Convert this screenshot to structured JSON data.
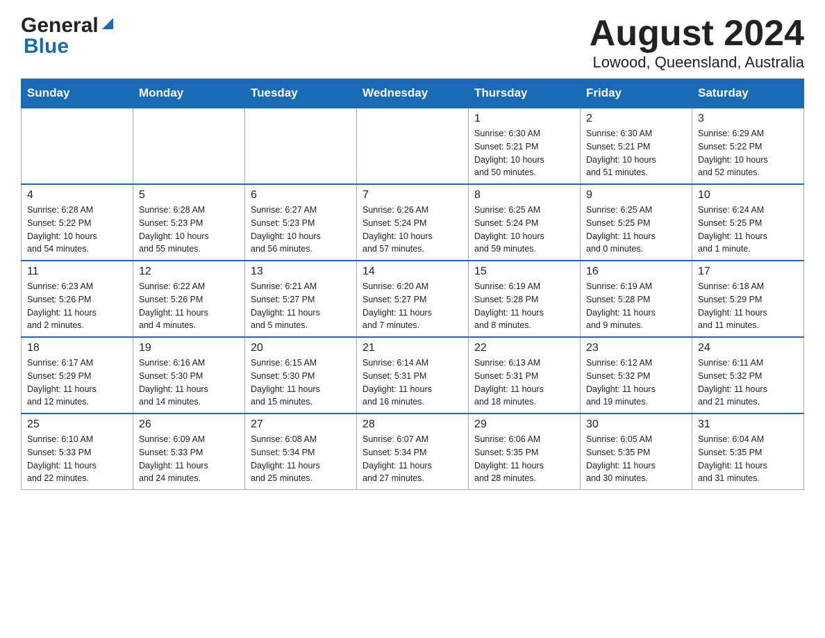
{
  "header": {
    "logo_general": "General",
    "logo_blue": "Blue",
    "title": "August 2024",
    "subtitle": "Lowood, Queensland, Australia"
  },
  "days_of_week": [
    "Sunday",
    "Monday",
    "Tuesday",
    "Wednesday",
    "Thursday",
    "Friday",
    "Saturday"
  ],
  "weeks": [
    [
      {
        "day": "",
        "info": ""
      },
      {
        "day": "",
        "info": ""
      },
      {
        "day": "",
        "info": ""
      },
      {
        "day": "",
        "info": ""
      },
      {
        "day": "1",
        "info": "Sunrise: 6:30 AM\nSunset: 5:21 PM\nDaylight: 10 hours\nand 50 minutes."
      },
      {
        "day": "2",
        "info": "Sunrise: 6:30 AM\nSunset: 5:21 PM\nDaylight: 10 hours\nand 51 minutes."
      },
      {
        "day": "3",
        "info": "Sunrise: 6:29 AM\nSunset: 5:22 PM\nDaylight: 10 hours\nand 52 minutes."
      }
    ],
    [
      {
        "day": "4",
        "info": "Sunrise: 6:28 AM\nSunset: 5:22 PM\nDaylight: 10 hours\nand 54 minutes."
      },
      {
        "day": "5",
        "info": "Sunrise: 6:28 AM\nSunset: 5:23 PM\nDaylight: 10 hours\nand 55 minutes."
      },
      {
        "day": "6",
        "info": "Sunrise: 6:27 AM\nSunset: 5:23 PM\nDaylight: 10 hours\nand 56 minutes."
      },
      {
        "day": "7",
        "info": "Sunrise: 6:26 AM\nSunset: 5:24 PM\nDaylight: 10 hours\nand 57 minutes."
      },
      {
        "day": "8",
        "info": "Sunrise: 6:25 AM\nSunset: 5:24 PM\nDaylight: 10 hours\nand 59 minutes."
      },
      {
        "day": "9",
        "info": "Sunrise: 6:25 AM\nSunset: 5:25 PM\nDaylight: 11 hours\nand 0 minutes."
      },
      {
        "day": "10",
        "info": "Sunrise: 6:24 AM\nSunset: 5:25 PM\nDaylight: 11 hours\nand 1 minute."
      }
    ],
    [
      {
        "day": "11",
        "info": "Sunrise: 6:23 AM\nSunset: 5:26 PM\nDaylight: 11 hours\nand 2 minutes."
      },
      {
        "day": "12",
        "info": "Sunrise: 6:22 AM\nSunset: 5:26 PM\nDaylight: 11 hours\nand 4 minutes."
      },
      {
        "day": "13",
        "info": "Sunrise: 6:21 AM\nSunset: 5:27 PM\nDaylight: 11 hours\nand 5 minutes."
      },
      {
        "day": "14",
        "info": "Sunrise: 6:20 AM\nSunset: 5:27 PM\nDaylight: 11 hours\nand 7 minutes."
      },
      {
        "day": "15",
        "info": "Sunrise: 6:19 AM\nSunset: 5:28 PM\nDaylight: 11 hours\nand 8 minutes."
      },
      {
        "day": "16",
        "info": "Sunrise: 6:19 AM\nSunset: 5:28 PM\nDaylight: 11 hours\nand 9 minutes."
      },
      {
        "day": "17",
        "info": "Sunrise: 6:18 AM\nSunset: 5:29 PM\nDaylight: 11 hours\nand 11 minutes."
      }
    ],
    [
      {
        "day": "18",
        "info": "Sunrise: 6:17 AM\nSunset: 5:29 PM\nDaylight: 11 hours\nand 12 minutes."
      },
      {
        "day": "19",
        "info": "Sunrise: 6:16 AM\nSunset: 5:30 PM\nDaylight: 11 hours\nand 14 minutes."
      },
      {
        "day": "20",
        "info": "Sunrise: 6:15 AM\nSunset: 5:30 PM\nDaylight: 11 hours\nand 15 minutes."
      },
      {
        "day": "21",
        "info": "Sunrise: 6:14 AM\nSunset: 5:31 PM\nDaylight: 11 hours\nand 16 minutes."
      },
      {
        "day": "22",
        "info": "Sunrise: 6:13 AM\nSunset: 5:31 PM\nDaylight: 11 hours\nand 18 minutes."
      },
      {
        "day": "23",
        "info": "Sunrise: 6:12 AM\nSunset: 5:32 PM\nDaylight: 11 hours\nand 19 minutes."
      },
      {
        "day": "24",
        "info": "Sunrise: 6:11 AM\nSunset: 5:32 PM\nDaylight: 11 hours\nand 21 minutes."
      }
    ],
    [
      {
        "day": "25",
        "info": "Sunrise: 6:10 AM\nSunset: 5:33 PM\nDaylight: 11 hours\nand 22 minutes."
      },
      {
        "day": "26",
        "info": "Sunrise: 6:09 AM\nSunset: 5:33 PM\nDaylight: 11 hours\nand 24 minutes."
      },
      {
        "day": "27",
        "info": "Sunrise: 6:08 AM\nSunset: 5:34 PM\nDaylight: 11 hours\nand 25 minutes."
      },
      {
        "day": "28",
        "info": "Sunrise: 6:07 AM\nSunset: 5:34 PM\nDaylight: 11 hours\nand 27 minutes."
      },
      {
        "day": "29",
        "info": "Sunrise: 6:06 AM\nSunset: 5:35 PM\nDaylight: 11 hours\nand 28 minutes."
      },
      {
        "day": "30",
        "info": "Sunrise: 6:05 AM\nSunset: 5:35 PM\nDaylight: 11 hours\nand 30 minutes."
      },
      {
        "day": "31",
        "info": "Sunrise: 6:04 AM\nSunset: 5:35 PM\nDaylight: 11 hours\nand 31 minutes."
      }
    ]
  ]
}
